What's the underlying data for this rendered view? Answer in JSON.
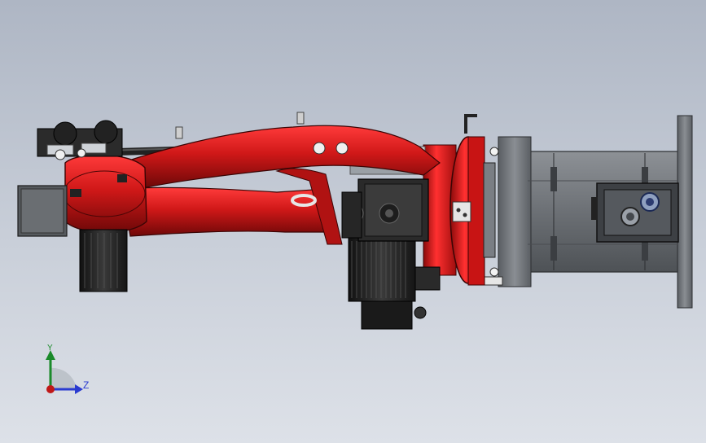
{
  "viewport": {
    "background_top": "#aeb6c4",
    "background_bottom": "#dde1e8"
  },
  "model": {
    "primary_color": "#d01818",
    "dark_red": "#7a0a0a",
    "motor_color": "#222222",
    "base_color": "#6f7378"
  },
  "triad": {
    "y_label": "Y",
    "z_label": "Z",
    "y_color": "#1a8a2a",
    "z_color": "#2a3bd0",
    "x_color": "#c01818"
  }
}
